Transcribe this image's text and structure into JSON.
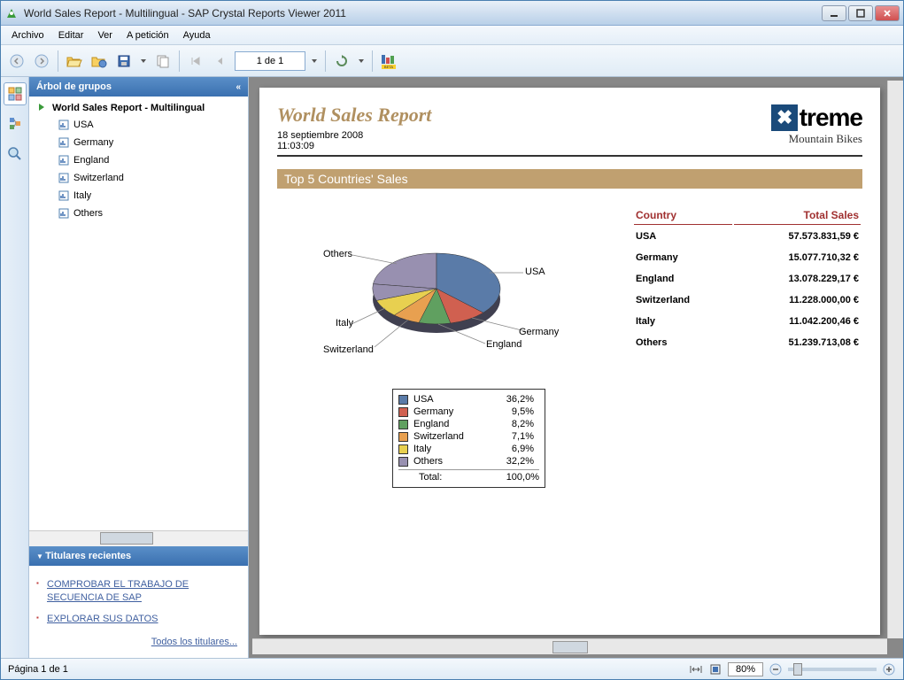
{
  "window": {
    "title": "World Sales Report - Multilingual - SAP Crystal Reports Viewer 2011"
  },
  "menu": {
    "archivo": "Archivo",
    "editar": "Editar",
    "ver": "Ver",
    "apeticion": "A petición",
    "ayuda": "Ayuda"
  },
  "toolbar": {
    "page_text": "1 de 1"
  },
  "sidebar": {
    "group_tree_title": "Árbol de grupos",
    "root": "World Sales Report - Multilingual",
    "items": [
      {
        "label": "USA"
      },
      {
        "label": "Germany"
      },
      {
        "label": "England"
      },
      {
        "label": "Switzerland"
      },
      {
        "label": "Italy"
      },
      {
        "label": "Others"
      }
    ],
    "recent_title": "Titulares recientes",
    "recent_links": [
      {
        "text": "COMPROBAR EL TRABAJO DE SECUENCIA DE SAP"
      },
      {
        "text": "EXPLORAR SUS DATOS"
      }
    ],
    "all_headlines": "Todos los titulares..."
  },
  "report": {
    "title": "World Sales Report",
    "date": "18 septiembre 2008",
    "time": "11:03:09",
    "logo_text": "treme",
    "logo_sub": "Mountain Bikes",
    "section_title": "Top 5 Countries' Sales",
    "table_header_country": "Country",
    "table_header_sales": "Total Sales",
    "rows": [
      {
        "country": "USA",
        "sales": "57.573.831,59 €"
      },
      {
        "country": "Germany",
        "sales": "15.077.710,32 €"
      },
      {
        "country": "England",
        "sales": "13.078.229,17 €"
      },
      {
        "country": "Switzerland",
        "sales": "11.228.000,00 €"
      },
      {
        "country": "Italy",
        "sales": "11.042.200,46 €"
      },
      {
        "country": "Others",
        "sales": "51.239.713,08 €"
      }
    ],
    "legend": [
      {
        "name": "USA",
        "pct": "36,2%",
        "color": "#5a7ba8"
      },
      {
        "name": "Germany",
        "pct": "9,5%",
        "color": "#d06050"
      },
      {
        "name": "England",
        "pct": "8,2%",
        "color": "#60a060"
      },
      {
        "name": "Switzerland",
        "pct": "7,1%",
        "color": "#e8a050"
      },
      {
        "name": "Italy",
        "pct": "6,9%",
        "color": "#e8d050"
      },
      {
        "name": "Others",
        "pct": "32,2%",
        "color": "#9890b0"
      }
    ],
    "legend_total_label": "Total:",
    "legend_total_value": "100,0%"
  },
  "status": {
    "page": "Página 1 de 1",
    "zoom": "80%"
  },
  "chart_data": {
    "type": "pie",
    "title": "Top 5 Countries' Sales",
    "series": [
      {
        "name": "USA",
        "value": 36.2,
        "sales_eur": 57573831.59
      },
      {
        "name": "Germany",
        "value": 9.5,
        "sales_eur": 15077710.32
      },
      {
        "name": "England",
        "value": 8.2,
        "sales_eur": 13078229.17
      },
      {
        "name": "Switzerland",
        "value": 7.1,
        "sales_eur": 11228000.0
      },
      {
        "name": "Italy",
        "value": 6.9,
        "sales_eur": 11042200.46
      },
      {
        "name": "Others",
        "value": 32.2,
        "sales_eur": 51239713.08
      }
    ]
  }
}
